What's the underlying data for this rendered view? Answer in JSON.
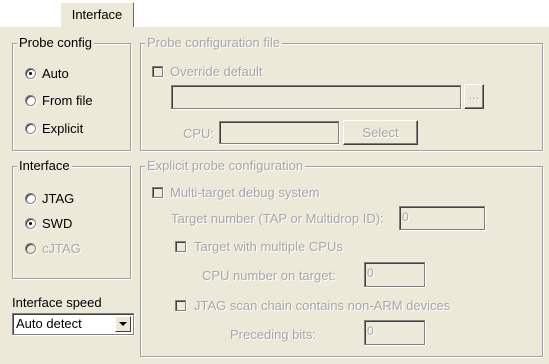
{
  "tab": {
    "label": "Interface"
  },
  "probe_config": {
    "title": "Probe config",
    "options": [
      "Auto",
      "From file",
      "Explicit"
    ],
    "selected": "Auto"
  },
  "probe_file": {
    "title": "Probe configuration file",
    "override_label": "Override default",
    "override_checked": false,
    "path_value": "",
    "browse_label": "...",
    "cpu_label": "CPU:",
    "cpu_value": "",
    "select_label": "Select"
  },
  "interface": {
    "title": "Interface",
    "options": [
      "JTAG",
      "SWD",
      "cJTAG"
    ],
    "selected": "SWD",
    "disabled_options": [
      "cJTAG"
    ]
  },
  "speed": {
    "label": "Interface speed",
    "value": "Auto detect"
  },
  "explicit": {
    "title": "Explicit probe configuration",
    "multi_target_label": "Multi-target debug system",
    "target_number_label": "Target number (TAP or Multidrop ID):",
    "target_number_value": "0",
    "multi_cpu_label": "Target with multiple CPUs",
    "cpu_number_label": "CPU number on target:",
    "cpu_number_value": "0",
    "jtag_chain_label": "JTAG scan chain contains non-ARM devices",
    "preceding_bits_label": "Preceding bits:",
    "preceding_bits_value": "0"
  }
}
